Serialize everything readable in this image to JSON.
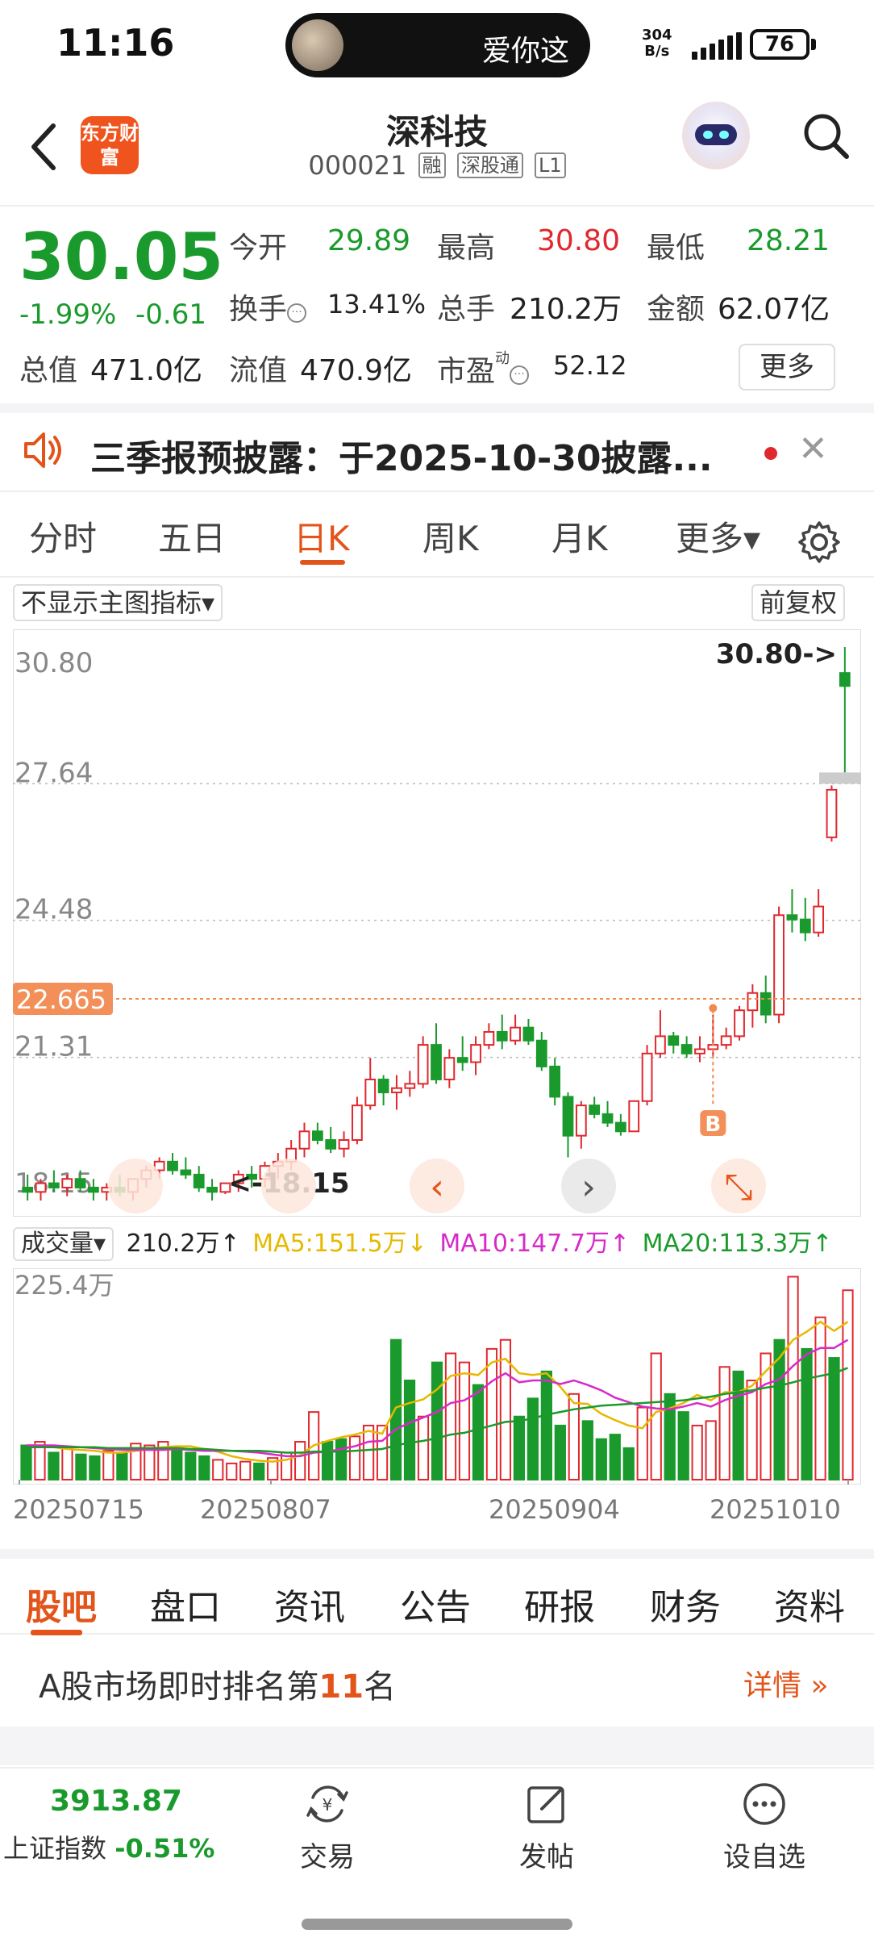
{
  "status": {
    "time": "11:16",
    "pill_text": "爱你这",
    "net_speed_value": "304",
    "net_speed_unit": "B/s",
    "battery": "76"
  },
  "header": {
    "logo_text": "东方财富",
    "stock_name": "深科技",
    "stock_code": "000021",
    "tags": [
      "融",
      "深股通",
      "L1"
    ]
  },
  "quote": {
    "price": "30.05",
    "change_pct": "-1.99%",
    "change": "-0.61",
    "open_label": "今开",
    "open": "29.89",
    "high_label": "最高",
    "high": "30.80",
    "low_label": "最低",
    "low": "28.21",
    "turnover_label": "换手",
    "turnover": "13.41%",
    "volume_label": "总手",
    "volume": "210.2万",
    "amount_label": "金额",
    "amount": "62.07亿",
    "mktcap_label": "总值",
    "mktcap": "471.0亿",
    "float_label": "流值",
    "float_cap": "470.9亿",
    "pe_label": "市盈",
    "pe_sup": "动",
    "pe": "52.12",
    "more_button": "更多"
  },
  "notice": {
    "text": "三季报预披露：于2025-10-30披露..."
  },
  "chart_tabs": {
    "items": [
      "分时",
      "五日",
      "日K",
      "周K",
      "月K",
      "更多▾"
    ],
    "active_index": 2
  },
  "chart_controls": {
    "indicator_select": "不显示主图指标▾",
    "adjust_select": "前复权"
  },
  "chart_data": [
    {
      "type": "candlestick",
      "title": "",
      "ylim": [
        18.15,
        30.8
      ],
      "y_ticks": [
        "30.80",
        "27.64",
        "24.48",
        "21.31",
        "18.15"
      ],
      "current_line": "22.665",
      "max_marker": "30.80->",
      "min_marker": "<-18.15",
      "signal_marker": "B",
      "candles": [
        {
          "o": 18.3,
          "h": 18.6,
          "l": 18.0,
          "c": 18.2
        },
        {
          "o": 18.2,
          "h": 18.5,
          "l": 18.0,
          "c": 18.4
        },
        {
          "o": 18.4,
          "h": 18.7,
          "l": 18.2,
          "c": 18.3
        },
        {
          "o": 18.3,
          "h": 18.6,
          "l": 18.1,
          "c": 18.5
        },
        {
          "o": 18.5,
          "h": 18.7,
          "l": 18.2,
          "c": 18.3
        },
        {
          "o": 18.3,
          "h": 18.5,
          "l": 18.0,
          "c": 18.2
        },
        {
          "o": 18.2,
          "h": 18.4,
          "l": 18.0,
          "c": 18.3
        },
        {
          "o": 18.3,
          "h": 18.6,
          "l": 18.1,
          "c": 18.2
        },
        {
          "o": 18.2,
          "h": 18.5,
          "l": 18.0,
          "c": 18.5
        },
        {
          "o": 18.5,
          "h": 18.8,
          "l": 18.3,
          "c": 18.7
        },
        {
          "o": 18.7,
          "h": 19.0,
          "l": 18.5,
          "c": 18.9
        },
        {
          "o": 18.9,
          "h": 19.1,
          "l": 18.6,
          "c": 18.7
        },
        {
          "o": 18.7,
          "h": 19.0,
          "l": 18.5,
          "c": 18.6
        },
        {
          "o": 18.6,
          "h": 18.8,
          "l": 18.2,
          "c": 18.3
        },
        {
          "o": 18.3,
          "h": 18.5,
          "l": 18.0,
          "c": 18.2
        },
        {
          "o": 18.2,
          "h": 18.4,
          "l": 18.15,
          "c": 18.4
        },
        {
          "o": 18.4,
          "h": 18.7,
          "l": 18.2,
          "c": 18.6
        },
        {
          "o": 18.6,
          "h": 18.8,
          "l": 18.3,
          "c": 18.5
        },
        {
          "o": 18.5,
          "h": 18.9,
          "l": 18.3,
          "c": 18.8
        },
        {
          "o": 18.8,
          "h": 19.1,
          "l": 18.5,
          "c": 18.9
        },
        {
          "o": 18.9,
          "h": 19.4,
          "l": 18.7,
          "c": 19.2
        },
        {
          "o": 19.2,
          "h": 19.8,
          "l": 19.0,
          "c": 19.6
        },
        {
          "o": 19.6,
          "h": 19.8,
          "l": 19.3,
          "c": 19.4
        },
        {
          "o": 19.4,
          "h": 19.7,
          "l": 19.1,
          "c": 19.2
        },
        {
          "o": 19.2,
          "h": 19.6,
          "l": 19.0,
          "c": 19.4
        },
        {
          "o": 19.4,
          "h": 20.4,
          "l": 19.3,
          "c": 20.2
        },
        {
          "o": 20.2,
          "h": 21.3,
          "l": 20.1,
          "c": 20.8
        },
        {
          "o": 20.8,
          "h": 20.9,
          "l": 20.2,
          "c": 20.5
        },
        {
          "o": 20.5,
          "h": 20.9,
          "l": 20.1,
          "c": 20.6
        },
        {
          "o": 20.6,
          "h": 21.0,
          "l": 20.4,
          "c": 20.7
        },
        {
          "o": 20.7,
          "h": 21.8,
          "l": 20.6,
          "c": 21.6
        },
        {
          "o": 21.6,
          "h": 22.1,
          "l": 20.7,
          "c": 20.8
        },
        {
          "o": 20.8,
          "h": 21.5,
          "l": 20.6,
          "c": 21.3
        },
        {
          "o": 21.3,
          "h": 21.8,
          "l": 21.0,
          "c": 21.2
        },
        {
          "o": 21.2,
          "h": 21.8,
          "l": 20.9,
          "c": 21.6
        },
        {
          "o": 21.6,
          "h": 22.1,
          "l": 21.5,
          "c": 21.9
        },
        {
          "o": 21.9,
          "h": 22.3,
          "l": 21.5,
          "c": 21.7
        },
        {
          "o": 21.7,
          "h": 22.3,
          "l": 21.6,
          "c": 22.0
        },
        {
          "o": 22.0,
          "h": 22.2,
          "l": 21.6,
          "c": 21.7
        },
        {
          "o": 21.7,
          "h": 21.9,
          "l": 21.0,
          "c": 21.1
        },
        {
          "o": 21.1,
          "h": 21.3,
          "l": 20.2,
          "c": 20.4
        },
        {
          "o": 20.4,
          "h": 20.5,
          "l": 19.0,
          "c": 19.5
        },
        {
          "o": 19.5,
          "h": 20.3,
          "l": 19.2,
          "c": 20.2
        },
        {
          "o": 20.2,
          "h": 20.4,
          "l": 19.9,
          "c": 20.0
        },
        {
          "o": 20.0,
          "h": 20.3,
          "l": 19.7,
          "c": 19.8
        },
        {
          "o": 19.8,
          "h": 20.0,
          "l": 19.5,
          "c": 19.6
        },
        {
          "o": 19.6,
          "h": 20.3,
          "l": 19.6,
          "c": 20.3
        },
        {
          "o": 20.3,
          "h": 21.6,
          "l": 20.2,
          "c": 21.4
        },
        {
          "o": 21.4,
          "h": 22.4,
          "l": 21.3,
          "c": 21.8
        },
        {
          "o": 21.8,
          "h": 21.9,
          "l": 21.4,
          "c": 21.6
        },
        {
          "o": 21.6,
          "h": 21.8,
          "l": 21.3,
          "c": 21.4
        },
        {
          "o": 21.4,
          "h": 21.8,
          "l": 21.2,
          "c": 21.5
        },
        {
          "o": 21.5,
          "h": 22.3,
          "l": 21.3,
          "c": 21.6
        },
        {
          "o": 21.6,
          "h": 22.0,
          "l": 21.5,
          "c": 21.8
        },
        {
          "o": 21.8,
          "h": 22.5,
          "l": 21.7,
          "c": 22.4
        },
        {
          "o": 22.4,
          "h": 23.0,
          "l": 22.0,
          "c": 22.8
        },
        {
          "o": 22.8,
          "h": 23.2,
          "l": 22.1,
          "c": 22.3
        },
        {
          "o": 22.3,
          "h": 24.8,
          "l": 22.1,
          "c": 24.6
        },
        {
          "o": 24.6,
          "h": 25.2,
          "l": 24.2,
          "c": 24.5
        },
        {
          "o": 24.5,
          "h": 25.0,
          "l": 24.0,
          "c": 24.2
        },
        {
          "o": 24.2,
          "h": 25.2,
          "l": 24.1,
          "c": 24.8
        },
        {
          "o": 26.4,
          "h": 27.6,
          "l": 26.3,
          "c": 27.5
        },
        {
          "o": 30.2,
          "h": 30.8,
          "l": 27.9,
          "c": 29.9
        }
      ]
    },
    {
      "type": "bar",
      "title": "成交量",
      "ylabel": "",
      "ylim": [
        0,
        225.4
      ],
      "y_top_label": "225.4万",
      "legend": [
        {
          "name": "210.2万↑",
          "color": "#222222"
        },
        {
          "name": "MA5:151.5万↓",
          "color": "#e6b800"
        },
        {
          "name": "MA10:147.7万↑",
          "color": "#d62bc8"
        },
        {
          "name": "MA20:113.3万↑",
          "color": "#1a9a2c"
        }
      ],
      "values": [
        38,
        42,
        30,
        35,
        28,
        26,
        32,
        30,
        40,
        38,
        42,
        35,
        30,
        26,
        22,
        18,
        20,
        18,
        24,
        30,
        42,
        75,
        42,
        45,
        48,
        60,
        60,
        155,
        110,
        70,
        130,
        140,
        130,
        105,
        145,
        155,
        70,
        90,
        120,
        60,
        95,
        65,
        45,
        50,
        35,
        80,
        140,
        95,
        75,
        60,
        65,
        125,
        120,
        110,
        140,
        155,
        225,
        145,
        180,
        135,
        210
      ],
      "up": [
        false,
        true,
        false,
        true,
        false,
        false,
        true,
        false,
        true,
        true,
        true,
        false,
        false,
        false,
        true,
        true,
        true,
        false,
        true,
        true,
        true,
        true,
        false,
        false,
        true,
        true,
        true,
        false,
        false,
        true,
        false,
        true,
        true,
        false,
        true,
        true,
        false,
        false,
        false,
        false,
        true,
        false,
        false,
        false,
        false,
        true,
        true,
        false,
        false,
        true,
        true,
        true,
        false,
        true,
        true,
        false,
        true,
        false,
        true,
        false,
        true
      ],
      "ma5": [
        38,
        38,
        36,
        34,
        33,
        32,
        30,
        30,
        32,
        34,
        36,
        37,
        37,
        34,
        31,
        26,
        23,
        21,
        20,
        22,
        27,
        38,
        43,
        47,
        50,
        54,
        51,
        80,
        85,
        89,
        100,
        115,
        118,
        116,
        130,
        134,
        118,
        116,
        118,
        103,
        85,
        84,
        73,
        66,
        60,
        57,
        75,
        79,
        85,
        94,
        88,
        97,
        97,
        104,
        120,
        135,
        155,
        164,
        175,
        165,
        175
      ],
      "ma10": [
        38,
        38,
        38,
        37,
        36,
        35,
        34,
        33,
        33,
        33,
        33,
        34,
        33,
        32,
        32,
        32,
        31,
        30,
        28,
        26,
        26,
        30,
        31,
        34,
        37,
        42,
        43,
        56,
        63,
        69,
        75,
        85,
        88,
        97,
        109,
        118,
        108,
        110,
        110,
        106,
        110,
        105,
        99,
        91,
        86,
        81,
        79,
        78,
        81,
        85,
        81,
        88,
        93,
        97,
        106,
        111,
        126,
        139,
        146,
        146,
        155
      ],
      "ma20": [
        36,
        36,
        36,
        36,
        36,
        36,
        35,
        35,
        35,
        35,
        35,
        35,
        34,
        34,
        33,
        32,
        32,
        32,
        31,
        30,
        30,
        31,
        31,
        31,
        32,
        33,
        34,
        38,
        41,
        43,
        46,
        50,
        52,
        56,
        60,
        64,
        65,
        68,
        72,
        75,
        78,
        80,
        82,
        83,
        84,
        85,
        86,
        87,
        88,
        90,
        92,
        95,
        97,
        99,
        102,
        104,
        108,
        112,
        115,
        118,
        124
      ]
    }
  ],
  "x_dates": [
    "20250715",
    "20250807",
    "20250904",
    "20251010"
  ],
  "bottom_tabs": {
    "items": [
      "股吧",
      "盘口",
      "资讯",
      "公告",
      "研报",
      "财务",
      "资料"
    ],
    "active_index": 0
  },
  "rank": {
    "prefix": "A股市场即时排名第",
    "number": "11",
    "suffix": "名",
    "more": "详情 »"
  },
  "bottom_bar": {
    "index_value": "3913.87",
    "index_name": "上证指数",
    "index_change": "-0.51%",
    "trade_label": "交易",
    "post_label": "发帖",
    "watch_label": "设自选"
  },
  "colors": {
    "up": "#e0282e",
    "down": "#1a9a2c",
    "accent": "#e2541a"
  }
}
